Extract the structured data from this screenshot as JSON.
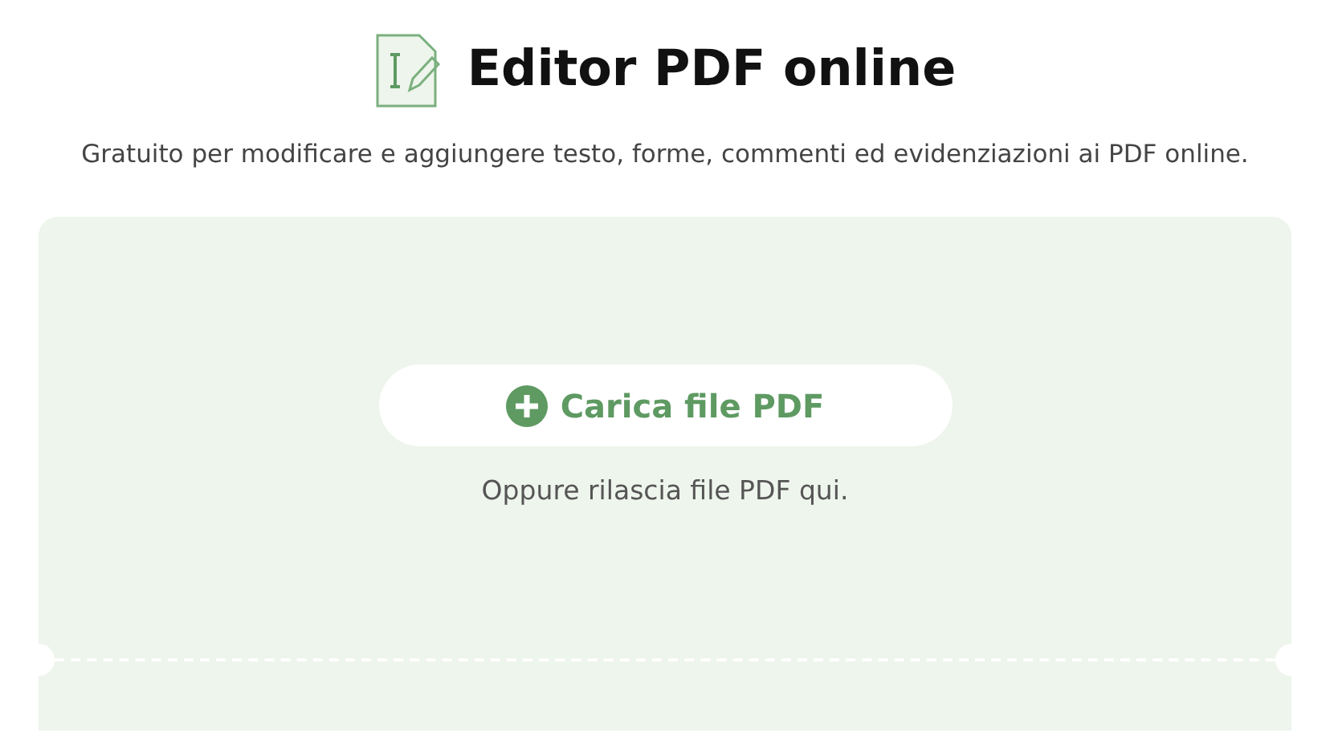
{
  "header": {
    "title": "Editor PDF online",
    "subtitle": "Gratuito per modificare e aggiungere testo, forme, commenti ed evidenziazioni ai PDF online."
  },
  "upload": {
    "button": "Carica file PDF",
    "hint": "Oppure rilascia file PDF qui."
  }
}
